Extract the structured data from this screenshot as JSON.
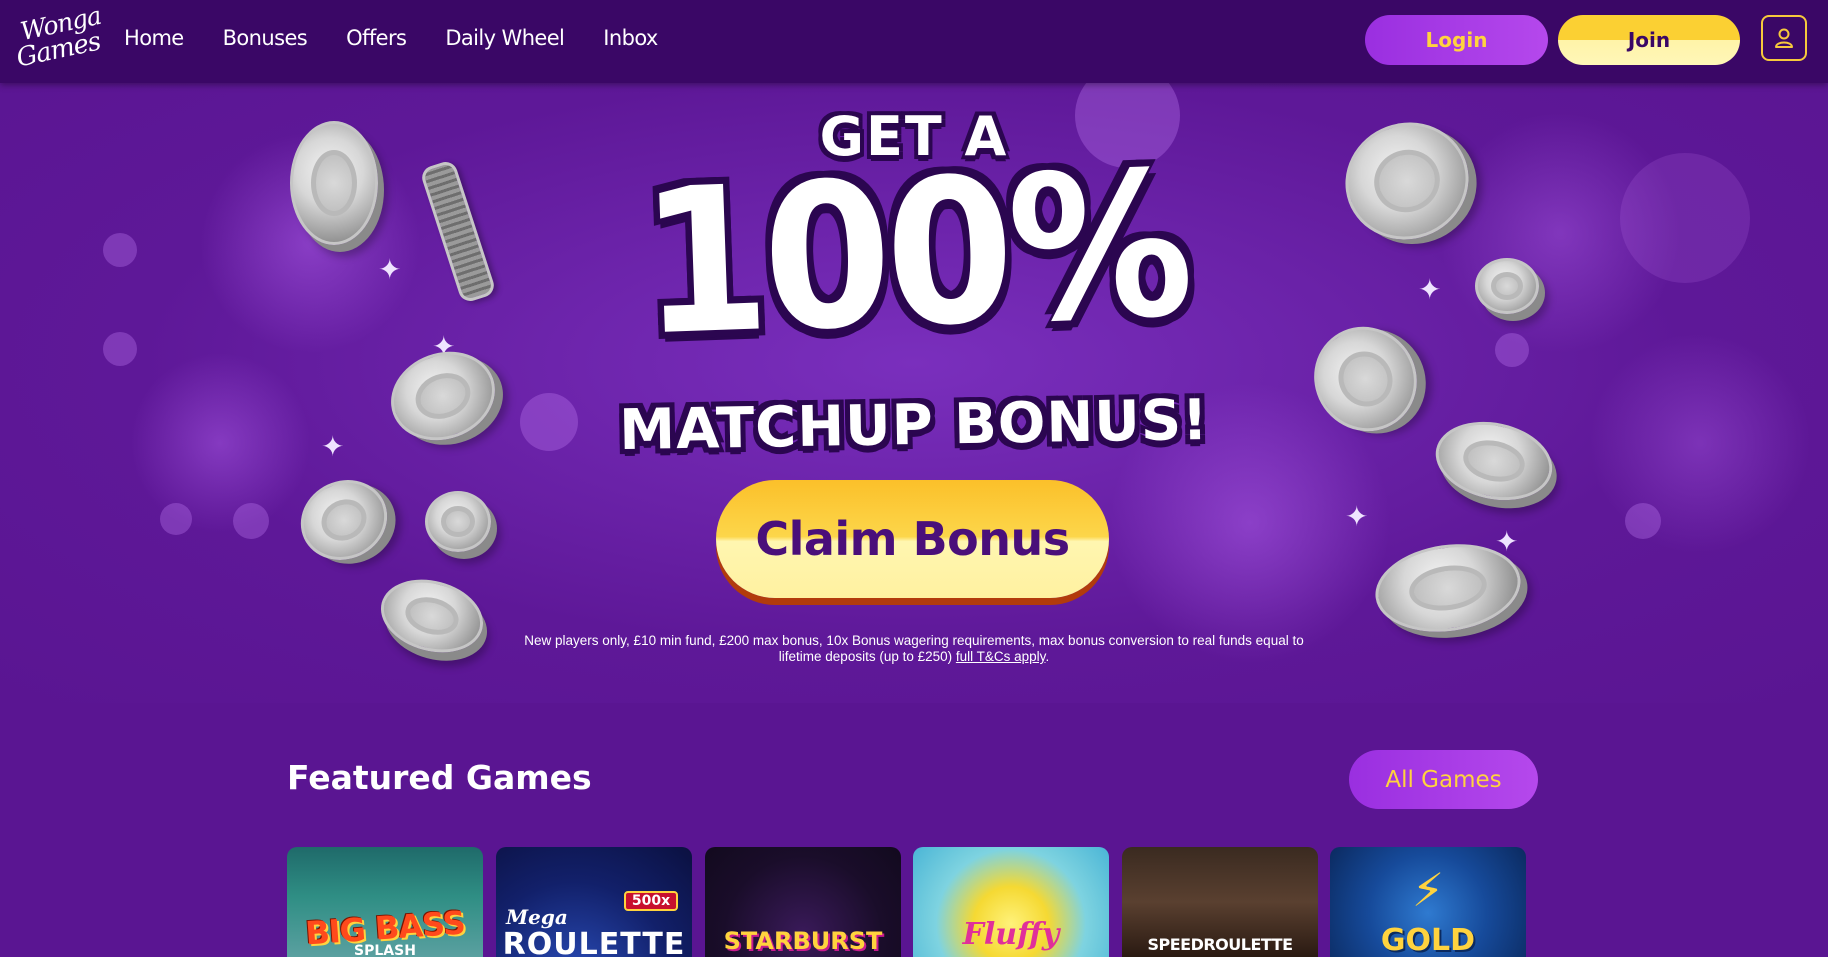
{
  "brand": {
    "line1": "Wonga",
    "line2": "Games"
  },
  "nav": {
    "items": [
      {
        "label": "Home"
      },
      {
        "label": "Bonuses"
      },
      {
        "label": "Offers"
      },
      {
        "label": "Daily Wheel"
      },
      {
        "label": "Inbox"
      }
    ]
  },
  "header": {
    "login_label": "Login",
    "join_label": "Join",
    "account_icon": "user-icon"
  },
  "hero": {
    "line1": "GET A",
    "line2": "100%",
    "line3": "MATCHUP BONUS!",
    "cta_label": "Claim Bonus",
    "terms_text": "New players only, £10 min fund, £200 max bonus, 10x Bonus wagering requirements, max bonus conversion to real funds equal to lifetime deposits (up to £250) ",
    "terms_link": "full T&Cs apply",
    "terms_end": "."
  },
  "featured": {
    "title": "Featured Games",
    "all_games_label": "All Games",
    "games": [
      {
        "name": "BIG BASS",
        "sub": "SPLASH"
      },
      {
        "name": "ROULETTE",
        "sub": "Mega",
        "badge": "500x"
      },
      {
        "name": "STARBURST"
      },
      {
        "name": "Fluffy"
      },
      {
        "name": "SPEEDROULETTE"
      },
      {
        "name": "GOLD"
      }
    ]
  },
  "colors": {
    "header_bg": "#3a0766",
    "hero_bg": "#5a1592",
    "accent_yellow": "#fbd033",
    "accent_purple": "#9a2fe0"
  }
}
